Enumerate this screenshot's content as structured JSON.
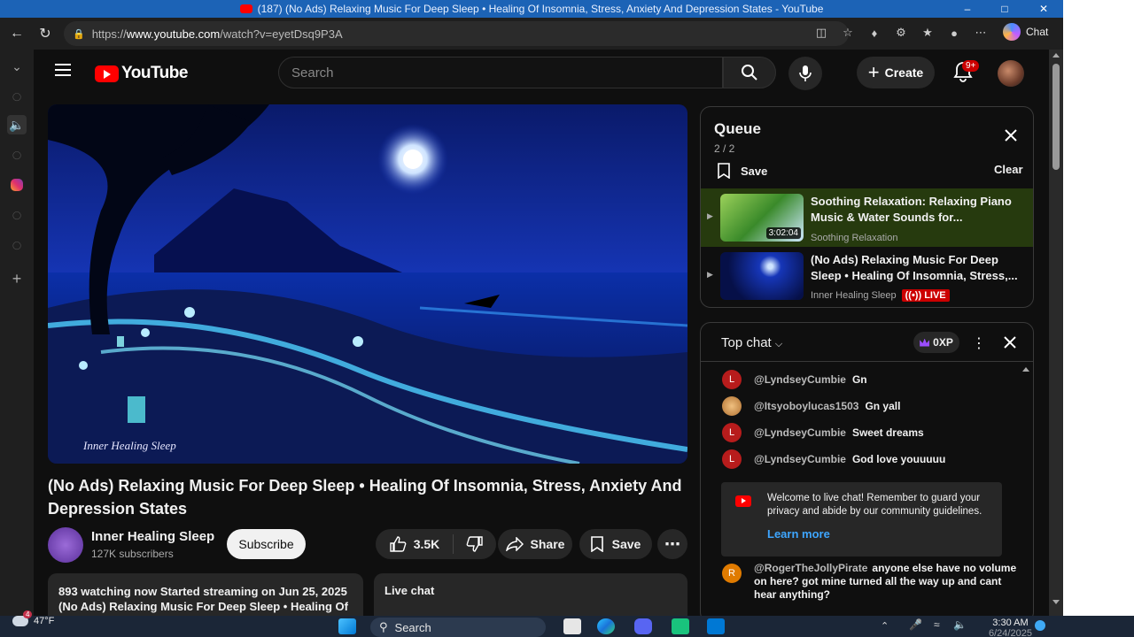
{
  "window": {
    "title": "(187) (No Ads) Relaxing Music For Deep Sleep • Healing Of Insomnia, Stress, Anxiety And Depression States - YouTube"
  },
  "browser": {
    "url_prefix": "https://",
    "url_domain": "www.youtube.com",
    "url_path": "/watch?v=eyetDsq9P3A",
    "chat_label": "Chat"
  },
  "header": {
    "logo_text": "YouTube",
    "search_placeholder": "Search",
    "create_label": "Create",
    "notifications_badge": "9+"
  },
  "video": {
    "title": "(No Ads) Relaxing Music For Deep Sleep • Healing Of Insomnia, Stress, Anxiety And Depression States",
    "watermark": "Inner Healing Sleep",
    "channel_name": "Inner Healing Sleep",
    "subscribers": "127K subscribers",
    "subscribe_label": "Subscribe",
    "likes": "3.5K",
    "share_label": "Share",
    "save_label": "Save",
    "description_line1": "893 watching now  Started streaming on Jun 25, 2025",
    "description_line2": "(No Ads) Relaxing Music For Deep Sleep • Healing Of",
    "live_chat_label": "Live chat"
  },
  "queue": {
    "title": "Queue",
    "count": "2 / 2",
    "save_label": "Save",
    "clear_label": "Clear",
    "items": [
      {
        "title": "Soothing Relaxation: Relaxing Piano Music & Water Sounds for...",
        "channel": "Soothing Relaxation",
        "duration": "3:02:04"
      },
      {
        "title": "(No Ads) Relaxing Music For Deep Sleep • Healing Of Insomnia, Stress,...",
        "channel": "Inner Healing Sleep",
        "live_label": "LIVE"
      }
    ]
  },
  "chat": {
    "mode_label": "Top chat",
    "xp_label": "0XP",
    "messages": [
      {
        "initial": "L",
        "author": "@LyndseyCumbie",
        "text": "Gn"
      },
      {
        "initial": "",
        "author": "@Itsyoboylucas1503",
        "text": "Gn yall"
      },
      {
        "initial": "L",
        "author": "@LyndseyCumbie",
        "text": "Sweet dreams"
      },
      {
        "initial": "L",
        "author": "@LyndseyCumbie",
        "text": "God love youuuuu"
      }
    ],
    "welcome_text": "Welcome to live chat! Remember to guard your privacy and abide by our community guidelines.",
    "learn_more": "Learn more",
    "last_message": {
      "initial": "R",
      "author": "@RogerTheJollyPirate",
      "text": "anyone else have no volume on here? got mine turned all the way up and cant hear anything?"
    }
  },
  "taskbar": {
    "temperature": "47°F",
    "weather_badge": "4",
    "search_label": "Search",
    "time": "3:30 AM",
    "date": "6/24/2025"
  }
}
